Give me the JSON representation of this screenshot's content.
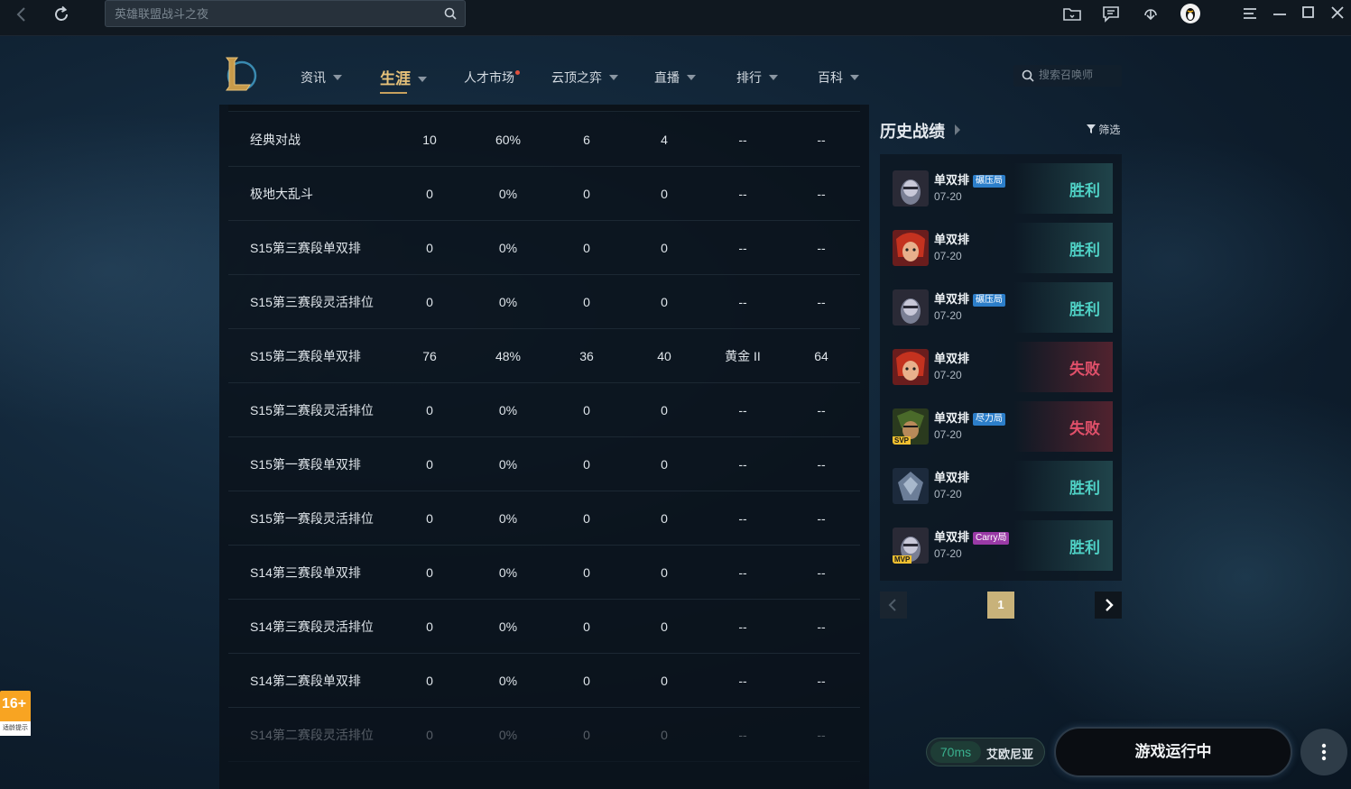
{
  "topbar": {
    "search_placeholder": "英雄联盟战斗之夜"
  },
  "nav": {
    "items": [
      {
        "label": "资讯",
        "caret": true
      },
      {
        "label": "生涯",
        "caret": true,
        "active": true
      },
      {
        "label": "人才市场",
        "caret": false,
        "dot": true
      },
      {
        "label": "云顶之弈",
        "caret": true
      },
      {
        "label": "直播",
        "caret": true
      },
      {
        "label": "排行",
        "caret": true
      },
      {
        "label": "百科",
        "caret": true
      }
    ],
    "summoner_search_placeholder": "搜索召唤师"
  },
  "stats_table": {
    "rows": [
      {
        "mode": "经典对战",
        "games": "10",
        "winrate": "60%",
        "wins": "6",
        "losses": "4",
        "rank": "--",
        "points": "--"
      },
      {
        "mode": "极地大乱斗",
        "games": "0",
        "winrate": "0%",
        "wins": "0",
        "losses": "0",
        "rank": "--",
        "points": "--"
      },
      {
        "mode": "S15第三赛段单双排",
        "games": "0",
        "winrate": "0%",
        "wins": "0",
        "losses": "0",
        "rank": "--",
        "points": "--"
      },
      {
        "mode": "S15第三赛段灵活排位",
        "games": "0",
        "winrate": "0%",
        "wins": "0",
        "losses": "0",
        "rank": "--",
        "points": "--"
      },
      {
        "mode": "S15第二赛段单双排",
        "games": "76",
        "winrate": "48%",
        "wins": "36",
        "losses": "40",
        "rank": "黄金 II",
        "points": "64"
      },
      {
        "mode": "S15第二赛段灵活排位",
        "games": "0",
        "winrate": "0%",
        "wins": "0",
        "losses": "0",
        "rank": "--",
        "points": "--"
      },
      {
        "mode": "S15第一赛段单双排",
        "games": "0",
        "winrate": "0%",
        "wins": "0",
        "losses": "0",
        "rank": "--",
        "points": "--"
      },
      {
        "mode": "S15第一赛段灵活排位",
        "games": "0",
        "winrate": "0%",
        "wins": "0",
        "losses": "0",
        "rank": "--",
        "points": "--"
      },
      {
        "mode": "S14第三赛段单双排",
        "games": "0",
        "winrate": "0%",
        "wins": "0",
        "losses": "0",
        "rank": "--",
        "points": "--"
      },
      {
        "mode": "S14第三赛段灵活排位",
        "games": "0",
        "winrate": "0%",
        "wins": "0",
        "losses": "0",
        "rank": "--",
        "points": "--"
      },
      {
        "mode": "S14第二赛段单双排",
        "games": "0",
        "winrate": "0%",
        "wins": "0",
        "losses": "0",
        "rank": "--",
        "points": "--"
      },
      {
        "mode": "S14第二赛段灵活排位",
        "games": "0",
        "winrate": "0%",
        "wins": "0",
        "losses": "0",
        "rank": "--",
        "points": "--"
      }
    ]
  },
  "history": {
    "title": "历史战绩",
    "filter_label": "筛选",
    "matches": [
      {
        "mode": "单双排",
        "tag": "碾压局",
        "tag_color": "#2c7ec9",
        "date": "07-20",
        "result": "胜利",
        "win": true,
        "champ": "ghost",
        "badge": ""
      },
      {
        "mode": "单双排",
        "tag": "",
        "tag_color": "",
        "date": "07-20",
        "result": "胜利",
        "win": true,
        "champ": "red",
        "badge": ""
      },
      {
        "mode": "单双排",
        "tag": "碾压局",
        "tag_color": "#2c7ec9",
        "date": "07-20",
        "result": "胜利",
        "win": true,
        "champ": "ghost",
        "badge": ""
      },
      {
        "mode": "单双排",
        "tag": "",
        "tag_color": "",
        "date": "07-20",
        "result": "失败",
        "win": false,
        "champ": "red",
        "badge": ""
      },
      {
        "mode": "单双排",
        "tag": "尽力局",
        "tag_color": "#2c7ec9",
        "date": "07-20",
        "result": "失败",
        "win": false,
        "champ": "green",
        "badge": "SVP"
      },
      {
        "mode": "单双排",
        "tag": "",
        "tag_color": "",
        "date": "07-20",
        "result": "胜利",
        "win": true,
        "champ": "blue",
        "badge": ""
      },
      {
        "mode": "单双排",
        "tag": "Carry局",
        "tag_color": "#9a3aa6",
        "date": "07-20",
        "result": "胜利",
        "win": true,
        "champ": "ghost",
        "badge": "MVP"
      }
    ],
    "current_page": "1"
  },
  "footer": {
    "ping": "70ms",
    "server": "艾欧尼亚",
    "launch_label": "游戏运行中",
    "age_rating": "16+",
    "age_note": "适龄提示"
  },
  "colors": {
    "accent_gold": "#c7a05d",
    "win": "#4fd1c5",
    "lose": "#e0506a"
  }
}
